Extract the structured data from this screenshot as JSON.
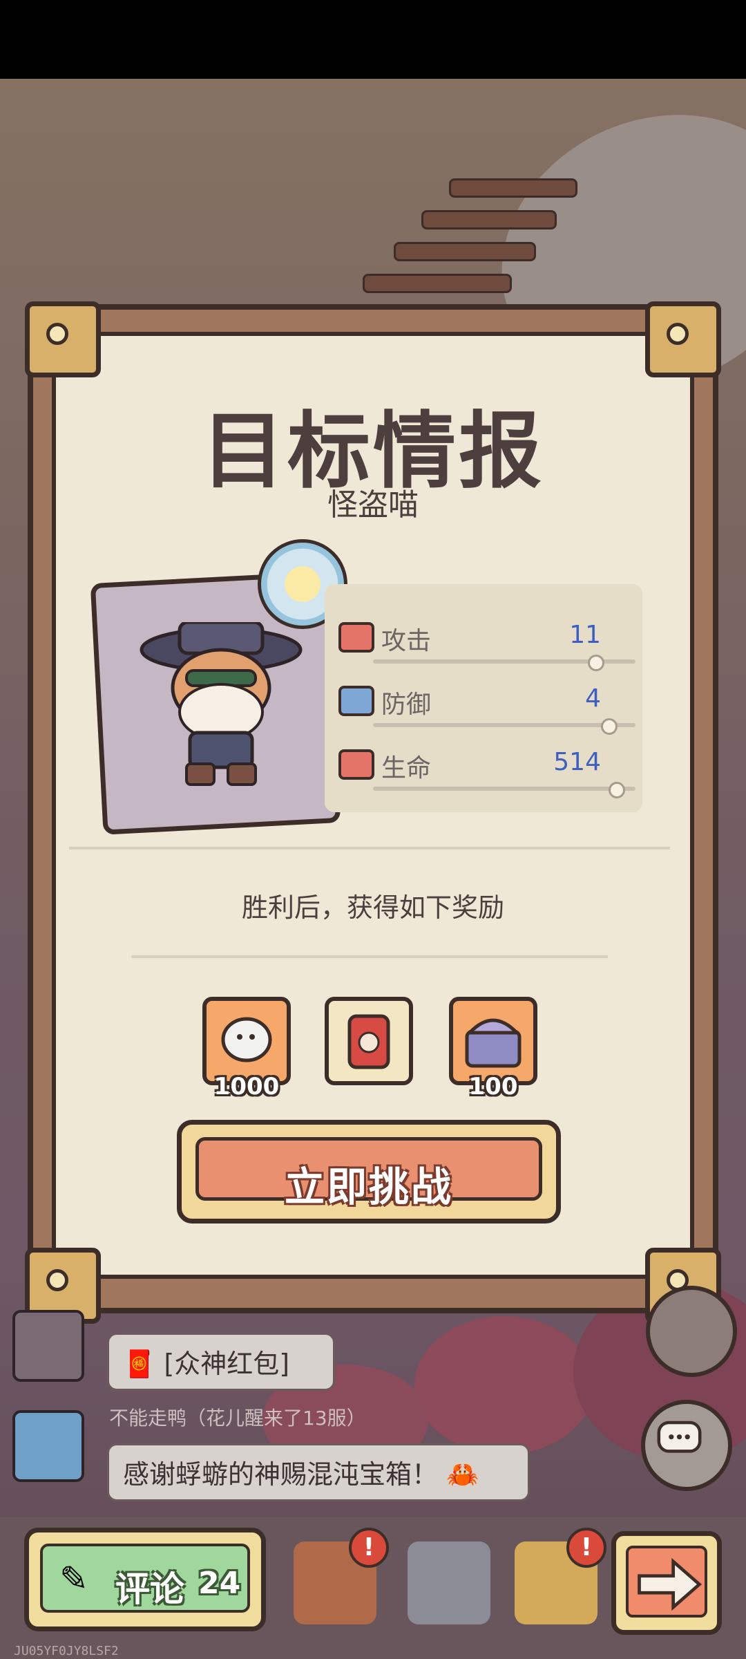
{
  "modal": {
    "title": "目标情报",
    "subtitle": "怪盗喵",
    "stats": [
      {
        "label": "攻击",
        "value": "11",
        "icon": "attack-icon",
        "level": 0.85
      },
      {
        "label": "防御",
        "value": "4",
        "icon": "defense-icon",
        "level": 0.9
      },
      {
        "label": "生命",
        "value": "514",
        "icon": "health-icon",
        "level": 0.93
      }
    ],
    "reward_title": "胜利后，获得如下奖励",
    "rewards": [
      {
        "name": "ghost-reward-icon",
        "count": "1000"
      },
      {
        "name": "canned-food-reward-icon",
        "count": ""
      },
      {
        "name": "treasure-chest-reward-icon",
        "count": "100"
      }
    ],
    "challenge_label": "立即挑战"
  },
  "chat": {
    "messages": [
      {
        "text": "[众神红包]"
      },
      {
        "user": "不能走鸭（花儿醒来了13服）",
        "text": "感谢蜉蝣的神赐混沌宝箱！"
      }
    ]
  },
  "bottom_bar": {
    "comment_label": "评论",
    "comment_count": "24"
  },
  "watermark": "JU05YF0JY8LSF2",
  "colors": {
    "paper": "#f0e8d6",
    "stat_value": "#3e5fc0",
    "challenge_button": "#e8906f",
    "comment_button": "#9fd79c"
  }
}
